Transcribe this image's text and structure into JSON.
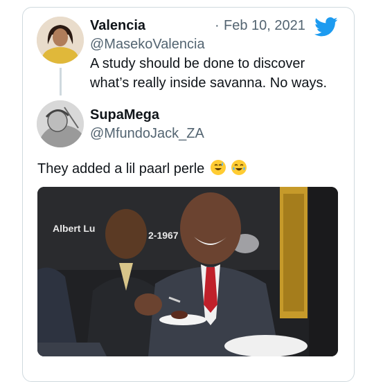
{
  "tweet": {
    "name": "Valencia",
    "handle": "@MasekoValencia",
    "date": "Feb 10, 2021",
    "date_separator": "·",
    "text_line1": "A study should be done to discover",
    "text_line2": "what’s really inside savanna. No ways."
  },
  "reply": {
    "name": "SupaMega",
    "handle": "@MfundoJack_ZA",
    "text": "They added a lil paarl perle",
    "emojis": [
      "sweat-smile-emoji",
      "tears-of-joy-emoji"
    ]
  },
  "photo": {
    "wall_text_left": "Albert Lu",
    "wall_text_right": "2-1967"
  },
  "colors": {
    "twitter_blue": "#1d9bf0",
    "muted": "#536471",
    "border": "#cfd9de"
  },
  "icons": [
    "twitter-bird-icon"
  ]
}
